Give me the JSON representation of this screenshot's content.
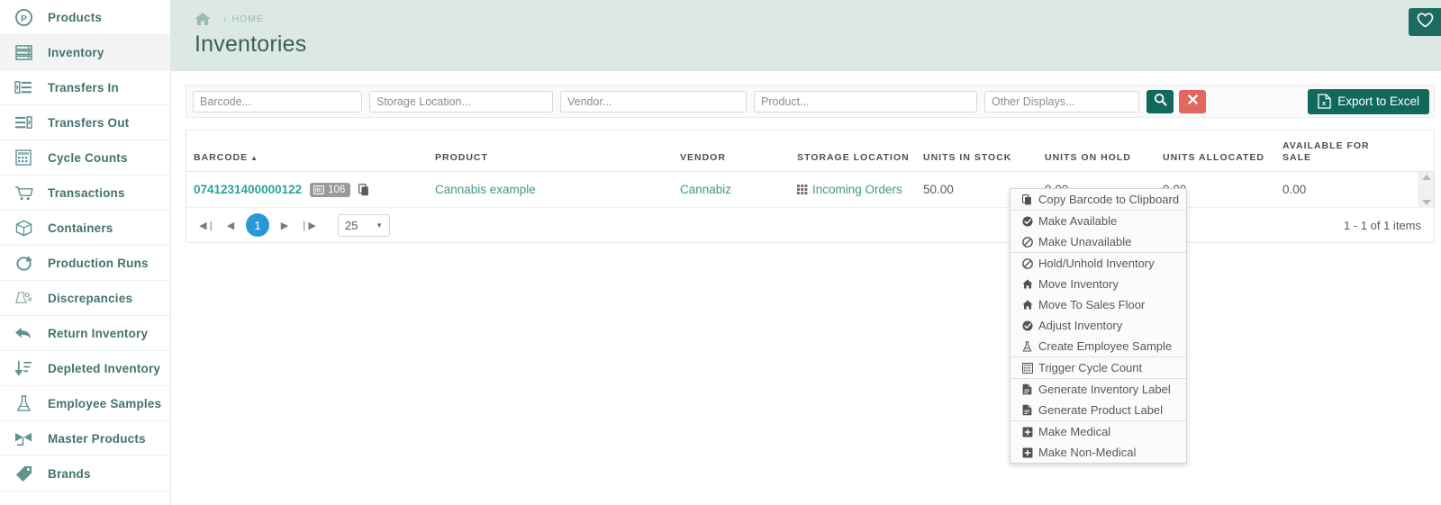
{
  "sidebar": {
    "items": [
      {
        "label": "Products",
        "icon": "product-circle-icon",
        "active": false
      },
      {
        "label": "Inventory",
        "icon": "inventory-rows-icon",
        "active": true
      },
      {
        "label": "Transfers In",
        "icon": "transfer-in-icon",
        "active": false
      },
      {
        "label": "Transfers Out",
        "icon": "transfer-out-icon",
        "active": false
      },
      {
        "label": "Cycle Counts",
        "icon": "calculator-icon",
        "active": false
      },
      {
        "label": "Transactions",
        "icon": "cart-icon",
        "active": false
      },
      {
        "label": "Containers",
        "icon": "box-icon",
        "active": false
      },
      {
        "label": "Production Runs",
        "icon": "loop-icon",
        "active": false
      },
      {
        "label": "Discrepancies",
        "icon": "discrepancy-icon",
        "active": false
      },
      {
        "label": "Return Inventory",
        "icon": "return-arrow-icon",
        "active": false
      },
      {
        "label": "Depleted Inventory",
        "icon": "sort-down-icon",
        "active": false
      },
      {
        "label": "Employee Samples",
        "icon": "flask-icon",
        "active": false
      },
      {
        "label": "Master Products",
        "icon": "master-products-icon",
        "active": false
      },
      {
        "label": "Brands",
        "icon": "tag-icon",
        "active": false
      }
    ]
  },
  "header": {
    "home_icon": "home-icon",
    "crumb_separator": "›",
    "breadcrumb": "HOME",
    "title": "Inventories",
    "favorite_icon": "heart-icon"
  },
  "filters": {
    "barcode_placeholder": "Barcode...",
    "barcode_value": "",
    "storage_placeholder": "Storage Location...",
    "storage_value": "",
    "vendor_placeholder": "Vendor...",
    "vendor_value": "",
    "product_placeholder": "Product...",
    "product_value": "",
    "other_placeholder": "Other Displays...",
    "other_value": "",
    "search_icon": "search-icon",
    "clear_icon": "close-x-icon",
    "export_label": "Export to Excel",
    "export_icon": "excel-file-icon"
  },
  "grid": {
    "columns": [
      {
        "key": "barcode",
        "label": "BARCODE",
        "sorted": true,
        "sort_caret": "▲"
      },
      {
        "key": "product",
        "label": "PRODUCT",
        "sorted": false,
        "sort_caret": ""
      },
      {
        "key": "vendor",
        "label": "VENDOR",
        "sorted": false,
        "sort_caret": ""
      },
      {
        "key": "location",
        "label": "STORAGE LOCATION",
        "sorted": false,
        "sort_caret": ""
      },
      {
        "key": "stock",
        "label": "UNITS IN STOCK",
        "sorted": false,
        "sort_caret": ""
      },
      {
        "key": "hold",
        "label": "UNITS ON HOLD",
        "sorted": false,
        "sort_caret": ""
      },
      {
        "key": "alloc",
        "label": "UNITS ALLOCATED",
        "sorted": false,
        "sort_caret": ""
      },
      {
        "key": "avail",
        "label": "AVAILABLE FOR SALE",
        "sorted": false,
        "sort_caret": ""
      }
    ],
    "rows": [
      {
        "barcode": "0741231400000122",
        "badge_count": "106",
        "badge_icon": "barcode-card-icon",
        "copy_icon": "copy-icon",
        "product": "Cannabis example",
        "vendor": "Cannabiz",
        "location": "Incoming Orders",
        "location_icon": "grid-squares-icon",
        "stock": "50.00",
        "hold": "0.00",
        "alloc": "0.00",
        "avail": "0.00"
      }
    ]
  },
  "pager": {
    "first_icon": "◀❘",
    "prev_icon": "◀",
    "next_icon": "▶",
    "last_icon": "❘▶",
    "current_page": "1",
    "page_size": "25",
    "page_size_caret": "▼",
    "info": "1 - 1 of 1 items"
  },
  "context_menu": {
    "groups": [
      {
        "items": [
          {
            "label": "Copy Barcode to Clipboard",
            "icon": "copy-icon"
          }
        ]
      },
      {
        "items": [
          {
            "label": "Make Available",
            "icon": "check-circle-icon"
          },
          {
            "label": "Make Unavailable",
            "icon": "ban-circle-icon"
          }
        ]
      },
      {
        "items": [
          {
            "label": "Hold/Unhold Inventory",
            "icon": "ban-circle-icon"
          },
          {
            "label": "Move Inventory",
            "icon": "home-solid-icon"
          },
          {
            "label": "Move To Sales Floor",
            "icon": "home-solid-icon"
          },
          {
            "label": "Adjust Inventory",
            "icon": "check-circle-icon"
          },
          {
            "label": "Create Employee Sample",
            "icon": "flask-icon"
          }
        ]
      },
      {
        "items": [
          {
            "label": "Trigger Cycle Count",
            "icon": "calculator-icon"
          }
        ]
      },
      {
        "items": [
          {
            "label": "Generate Inventory Label",
            "icon": "file-icon"
          },
          {
            "label": "Generate Product Label",
            "icon": "file-icon"
          }
        ]
      },
      {
        "items": [
          {
            "label": "Make Medical",
            "icon": "plus-square-icon"
          },
          {
            "label": "Make Non-Medical",
            "icon": "plus-square-icon"
          }
        ]
      }
    ]
  },
  "colors": {
    "brand_teal": "#11695d",
    "header_band": "#dbe8e4",
    "link_teal": "#3a9a8c",
    "danger_red": "#e2685f",
    "page_blue": "#2a97d8"
  }
}
